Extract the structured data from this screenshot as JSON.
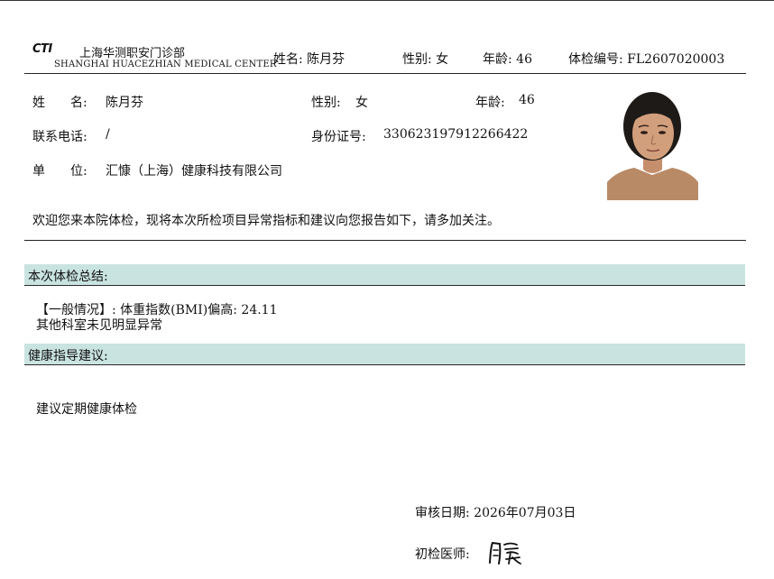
{
  "header": {
    "logo_text": "CTI",
    "org_name_cn": "上海华测职安门诊部",
    "org_name_en": "SHANGHAI HUACEZHIAN MEDICAL CENTER",
    "name": "姓名: 陈月芬",
    "gender": "性别: 女",
    "age": "年龄: 46",
    "exam_no": "体检编号: FL2607020003"
  },
  "patient": {
    "name_label": "姓　　名:",
    "name_value": "陈月芬",
    "gender_label": "性别:",
    "gender_value": "女",
    "age_label": "年龄:",
    "age_value": "46",
    "phone_label": "联系电话:",
    "phone_value": "/",
    "id_label": "身份证号:",
    "id_value": "330623197912266422",
    "unit_label": "单　　位:",
    "unit_value": "汇慷（上海）健康科技有限公司"
  },
  "welcome": "欢迎您来本院体检，现将本次所检项目异常指标和建议向您报告如下，请多加关注。",
  "summary": {
    "title": "本次体检总结:",
    "line1": "【一般情况】: 体重指数(BMI)偏高: 24.11",
    "line2": "其他科室未见明显异常"
  },
  "advice": {
    "title": "健康指导建议:",
    "line1": "建议定期健康体检"
  },
  "footer": {
    "review_date": "审核日期: 2026年07月03日",
    "doctor_label": "初检医师:"
  },
  "colors": {
    "band": "#c9e3e0"
  }
}
